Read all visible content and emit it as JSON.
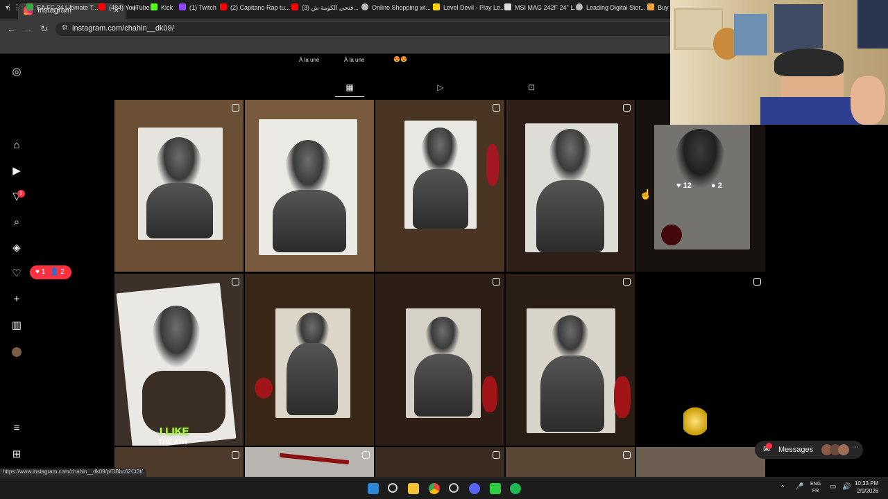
{
  "browser": {
    "tab_title": "Instagram",
    "url": "instagram.com/chahin__dk09/",
    "bookmarks": [
      "EA FC 24 Ultimate T...",
      "(484) YouTube",
      "Kick",
      "(1) Twitch",
      "(2) Capitano Rap tu...",
      "(3) فتحي الكومة ش...",
      "Online Shopping wi...",
      "Level Devil - Play Le...",
      "MSI MAG 242F 24\" L...",
      "Leading Digital Stor...",
      "Buy P"
    ],
    "status_url": "https://www.instagram.com/chahin__dk09/p/DBbc62Ct3t/"
  },
  "highlights": [
    "À la une",
    "À la une",
    "😍😍"
  ],
  "notifications": {
    "likes": "1",
    "follows": "2",
    "badge": "5"
  },
  "hover_post": {
    "likes": "12",
    "comments": "2"
  },
  "caption_overlay": {
    "line1": "I LIKE",
    "line2": "THE 4TH"
  },
  "messages": {
    "label": "Messages",
    "badge": "5"
  },
  "taskbar": {
    "lang1": "ENG",
    "lang2": "FR",
    "time": "10:33 PM",
    "date": "2/9/2026"
  },
  "colors": {
    "accent": "#ff3040",
    "bg": "#000000"
  }
}
